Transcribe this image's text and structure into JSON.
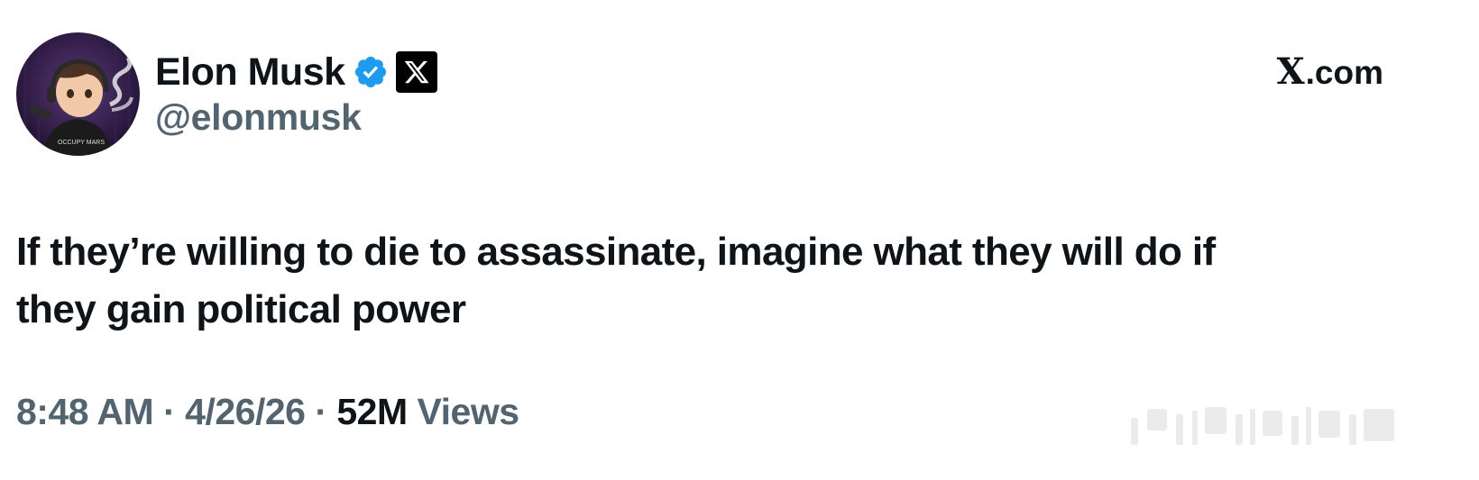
{
  "author": {
    "display_name": "Elon Musk",
    "handle": "@elonmusk",
    "verified_icon": "verified-badge-icon",
    "affiliation_icon": "x-logo-icon",
    "avatar_text": "OCCUPY MARS"
  },
  "site": {
    "label": ".com",
    "logo": "X"
  },
  "tweet": {
    "line1": "If they’re willing to die to assassinate, imagine what they will do if",
    "line2": "they gain political power"
  },
  "meta": {
    "time": "8:48 AM",
    "sep1": " · ",
    "date": "4/26/26",
    "sep2": " · ",
    "views_count": "52M",
    "views_label": " Views"
  },
  "colors": {
    "primary_text": "#0f1419",
    "secondary_text": "#536471",
    "verified_blue": "#1d9bf0"
  }
}
